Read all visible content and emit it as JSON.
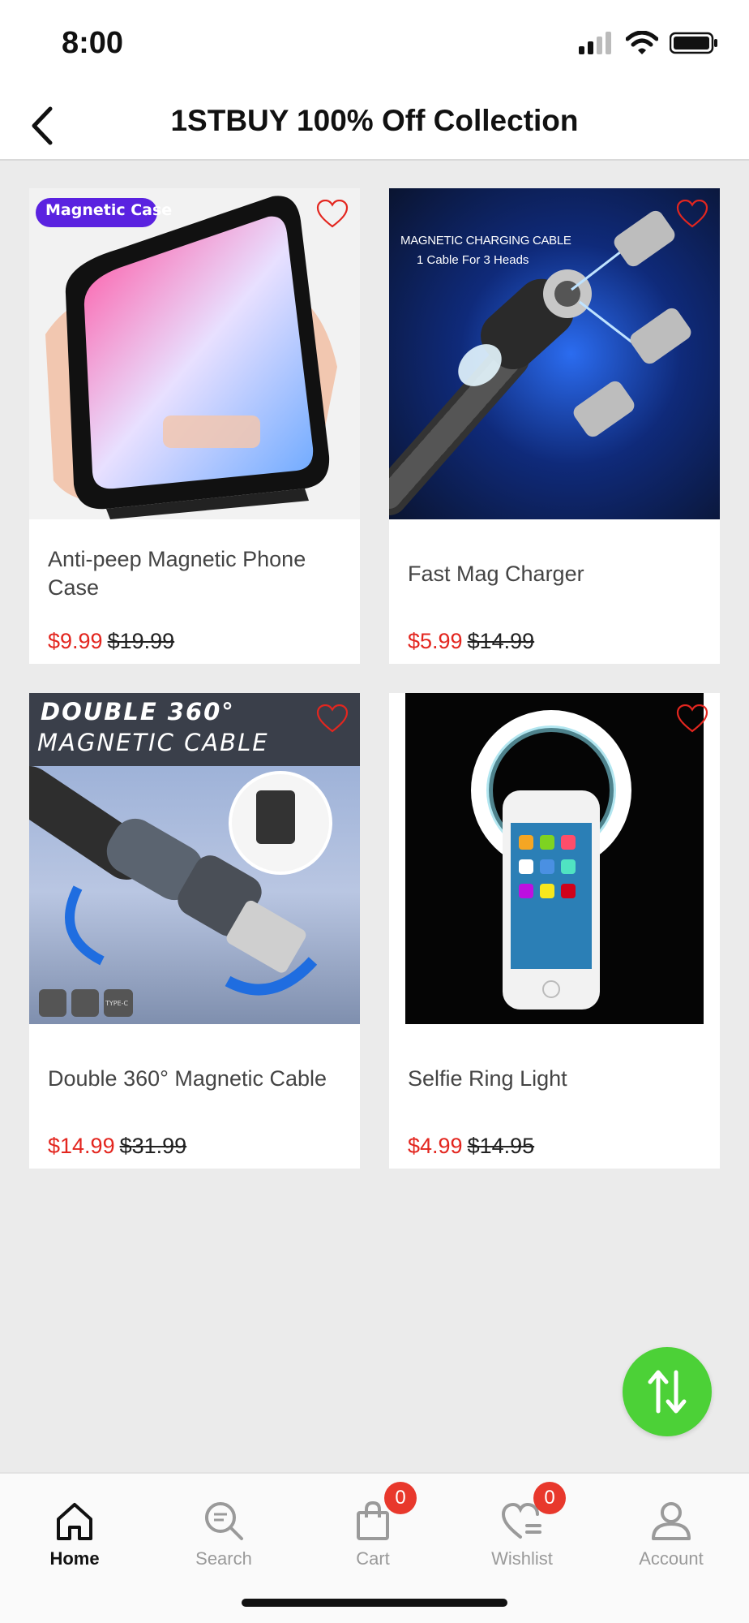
{
  "status": {
    "time": "8:00"
  },
  "header": {
    "title": "1STBUY 100% Off Collection"
  },
  "products": [
    {
      "name": "Anti-peep Magnetic Phone Case",
      "price": "$9.99",
      "old_price": "$19.99",
      "image_label": "Magnetic Case"
    },
    {
      "name": "Fast Mag Charger",
      "price": "$5.99",
      "old_price": "$14.99",
      "image_label": "MAGNETIC CHARGING CABLE",
      "image_sublabel": "1 Cable For 3 Heads"
    },
    {
      "name": "Double 360° Magnetic Cable",
      "price": "$14.99",
      "old_price": "$31.99",
      "image_label": "DOUBLE 360°",
      "image_sublabel": "MAGNETIC CABLE",
      "image_badge": "TYPE-C"
    },
    {
      "name": "Selfie Ring Light",
      "price": "$4.99",
      "old_price": "$14.95"
    }
  ],
  "tabs": [
    {
      "label": "Home",
      "icon": "home-icon",
      "active": true
    },
    {
      "label": "Search",
      "icon": "search-icon"
    },
    {
      "label": "Cart",
      "icon": "cart-icon",
      "badge": "0"
    },
    {
      "label": "Wishlist",
      "icon": "wishlist-icon",
      "badge": "0"
    },
    {
      "label": "Account",
      "icon": "account-icon"
    }
  ],
  "colors": {
    "price": "#e3261f",
    "fab": "#4cd137",
    "badge": "#e8382c",
    "heart": "#e3261f"
  }
}
